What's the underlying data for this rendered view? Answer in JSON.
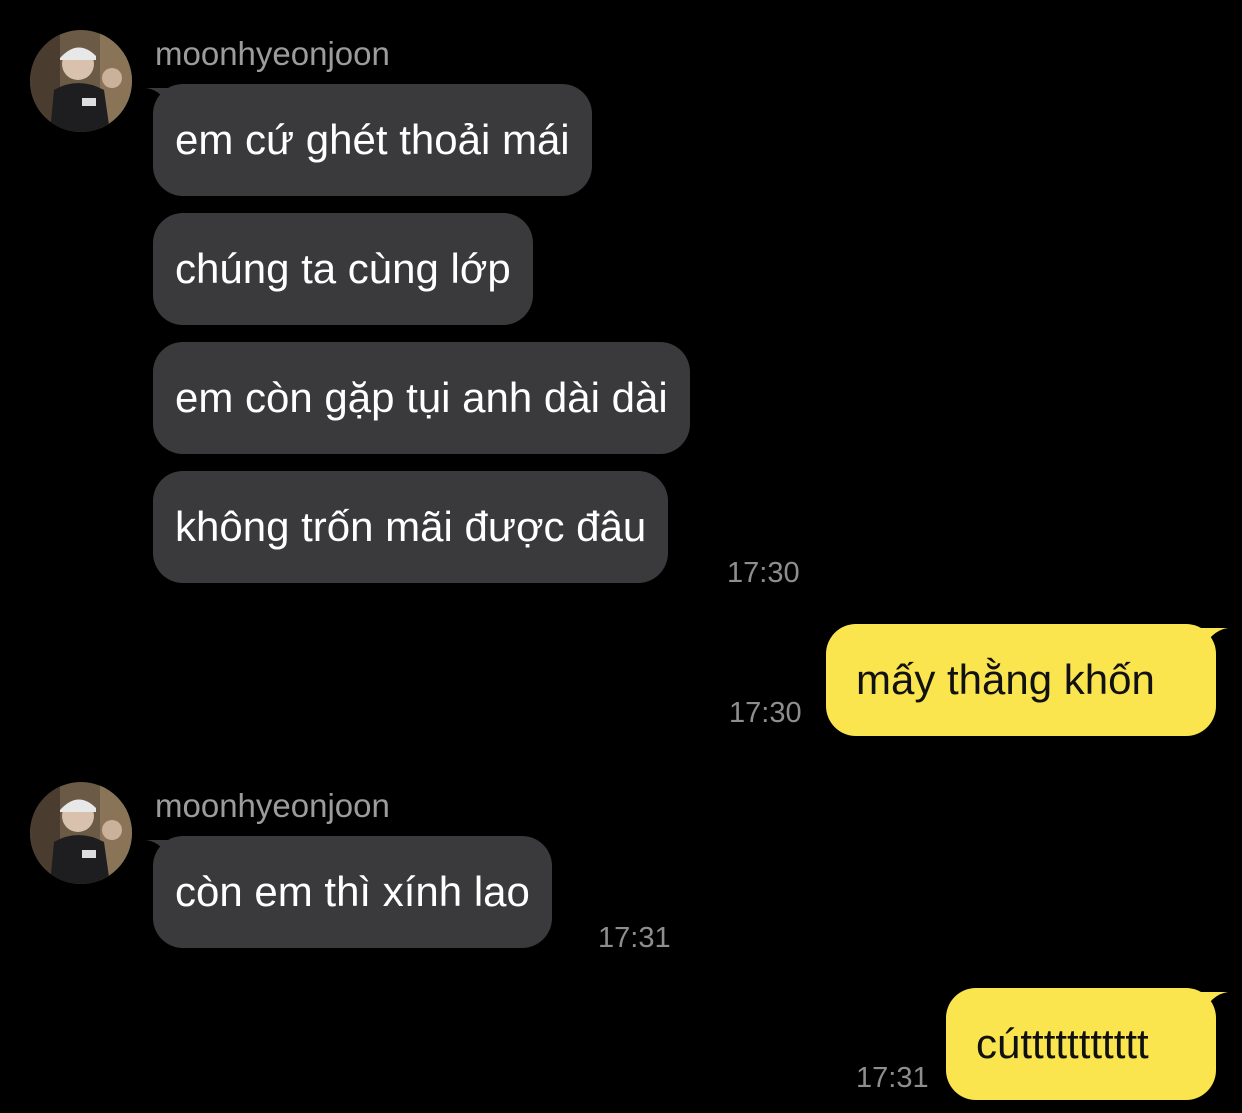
{
  "colors": {
    "background": "#000000",
    "incoming_bubble": "#3a3a3c",
    "outgoing_bubble": "#fae54f",
    "sender_text": "#9c9c9c",
    "time_text": "#8e8e8e"
  },
  "chat": {
    "group1": {
      "sender": "moonhyeonjoon",
      "messages": [
        "em cứ ghét thoải mái",
        "chúng ta cùng lớp",
        "em còn gặp tụi anh dài dài",
        "không trốn mãi được đâu"
      ],
      "time": "17:30"
    },
    "reply1": {
      "text": "mấy thằng khốn",
      "time": "17:30"
    },
    "group2": {
      "sender": "moonhyeonjoon",
      "messages": [
        "còn em thì xính lao"
      ],
      "time": "17:31"
    },
    "reply2": {
      "text": "cúttttttttttt",
      "time": "17:31"
    }
  }
}
